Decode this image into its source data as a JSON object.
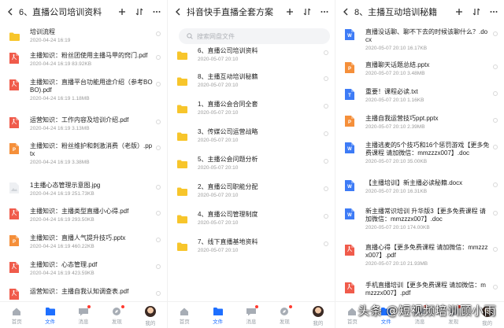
{
  "panels": [
    {
      "title": "6、直播公司培训资料",
      "items": [
        {
          "type": "folder",
          "name": "培训流程",
          "meta": "2020-04-24  16:19"
        },
        {
          "type": "pdf",
          "name": "主播知识：粉丝团使用主播马甲的窍门.pdf",
          "meta": "2020-04-24  16:19   83.92KB"
        },
        {
          "type": "pdf",
          "name": "主播知识：直播平台功能用途介绍（参考BOBO).pdf",
          "meta": "2020-04-24  16:19   1.18MB"
        },
        {
          "type": "pdf",
          "name": "运营知识：工作内容及培训介绍.pdf",
          "meta": "2020-04-24  16:19   3.13MB"
        },
        {
          "type": "ppt",
          "name": "主播知识：粉丝维护和刺激消费（老版）.pptx",
          "meta": "2020-04-24  16:19   3.38MB"
        },
        {
          "type": "img",
          "name": "1主播心态管理示意图.jpg",
          "meta": "2020-04-24  16:19   251.73KB"
        },
        {
          "type": "pdf",
          "name": "主播知识：主播类型直播小心得.pdf",
          "meta": "2020-04-24  16:19   293.50KB"
        },
        {
          "type": "ppt",
          "name": "主播知识：直播人气提升技巧.pptx",
          "meta": "2020-04-24  16:19   460.22KB"
        },
        {
          "type": "pdf",
          "name": "主播知识：心态管理.pdf",
          "meta": "2020-04-24  16:19   423.59KB"
        },
        {
          "type": "pdf",
          "name": "运营知识：主播自我认知调查表.pdf",
          "meta": ""
        }
      ]
    },
    {
      "title": "抖音快手直播全套方案",
      "search_placeholder": "搜索网盘文件",
      "items": [
        {
          "type": "folder",
          "name": "6、直播公司培训资料",
          "meta": "2020-05-07  20:10"
        },
        {
          "type": "folder",
          "name": "8、主播互动培训秘籍",
          "meta": "2020-05-07  20:10"
        },
        {
          "type": "folder",
          "name": "1、直播公会合同全套",
          "meta": "2020-05-07  20:10"
        },
        {
          "type": "folder",
          "name": "3、传媒公司运营战略",
          "meta": "2020-05-07  20:10"
        },
        {
          "type": "folder",
          "name": "5、主播公会问题分析",
          "meta": "2020-05-07  20:10"
        },
        {
          "type": "folder",
          "name": "2、直播公司职能分配",
          "meta": "2020-05-07  20:10"
        },
        {
          "type": "folder",
          "name": "4、直播公司管理制度",
          "meta": "2020-05-07  20:10"
        },
        {
          "type": "folder",
          "name": "7、线下直播基地资料",
          "meta": "2020-05-07  20:10"
        }
      ]
    },
    {
      "title": "8、主播互动培训秘籍",
      "items": [
        {
          "type": "doc",
          "name": "直播没话聊、聊不下去的时候该聊什么？.docx",
          "meta": "2020-05-07  20:10   16.17KB"
        },
        {
          "type": "ppt",
          "name": "直播聊天话题总结.pptx",
          "meta": "2020-05-07  20:10   3.48MB"
        },
        {
          "type": "txt",
          "name": "重要！课程必读.txt",
          "meta": "2020-05-07  20:10   1.16KB"
        },
        {
          "type": "ppt",
          "name": "主播自我运营技巧ppt.pptx",
          "meta": "2020-05-07  20:10   2.39MB"
        },
        {
          "type": "doc",
          "name": "主播逃麦的5个技巧和16个惩罚游戏【更多免费课程 请加微信：mmzzzx007】.doc",
          "meta": "2020-05-07  20:10   35.00KB"
        },
        {
          "type": "doc",
          "name": "【主播培训】新主播必读秘籍.docx",
          "meta": "2020-05-07  20:10   16.31KB"
        },
        {
          "type": "doc",
          "name": "新主播常识培训 升华版3【更多免费课程 请加微信：mmzzzx007】.doc",
          "meta": "2020-05-07  20:10   174.00KB"
        },
        {
          "type": "pdf",
          "name": "直播心得【更多免费课程 请加微信：mmzzzx007】.pdf",
          "meta": "2020-05-07  20:10   21.93MB"
        },
        {
          "type": "pdf",
          "name": "手机直播培训【更多免费课程 请加微信：mmzzzx007】.pdf",
          "meta": ""
        }
      ]
    }
  ],
  "tabs": [
    {
      "label": "首页",
      "icon": "home-icon"
    },
    {
      "label": "文件",
      "icon": "folder-icon"
    },
    {
      "label": "消息",
      "icon": "message-icon"
    },
    {
      "label": "发现",
      "icon": "discover-icon"
    },
    {
      "label": "我的",
      "icon": "avatar"
    }
  ],
  "watermark": "头条 @短视频培训顾小雨",
  "colors": {
    "folder": "#f7c52b",
    "pdf": "#f05b4b",
    "ppt": "#f58f3a",
    "doc": "#3d7bf6",
    "txt": "#3d7bf6",
    "img": "#cfd3d8",
    "active_tab": "#1e6fff",
    "badge": "#ff3b30"
  }
}
